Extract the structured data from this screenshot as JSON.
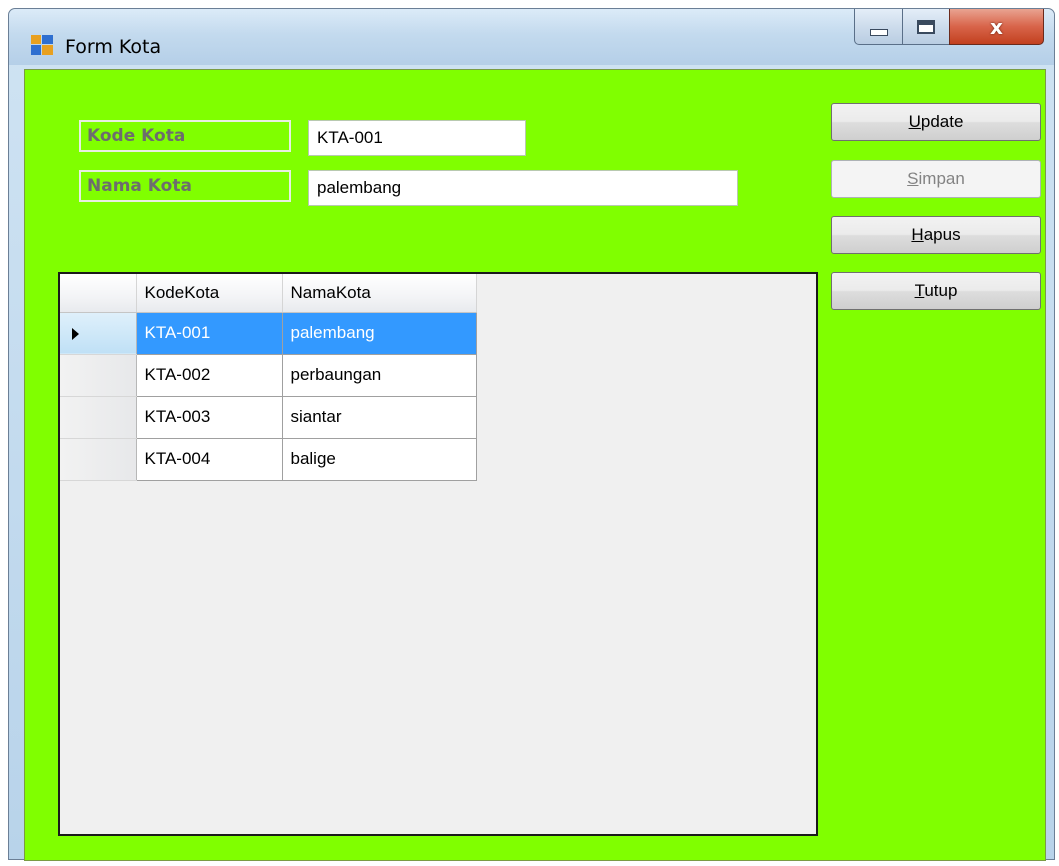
{
  "window": {
    "title": "Form Kota"
  },
  "form": {
    "kode_label": "Kode Kota",
    "kode_value": "KTA-001",
    "nama_label": "Nama Kota",
    "nama_value": "palembang"
  },
  "buttons": {
    "update": {
      "label": "Update",
      "mnemonic": "U",
      "rest": "pdate"
    },
    "simpan": {
      "label": "Simpan",
      "mnemonic": "S",
      "rest": "impan",
      "enabled": false
    },
    "hapus": {
      "label": "Hapus",
      "mnemonic": "H",
      "rest": "apus"
    },
    "tutup": {
      "label": "Tutup",
      "mnemonic": "T",
      "rest": "utup"
    }
  },
  "grid": {
    "columns": [
      "KodeKota",
      "NamaKota"
    ],
    "rows": [
      {
        "kode": "KTA-001",
        "nama": "palembang",
        "selected": true
      },
      {
        "kode": "KTA-002",
        "nama": "perbaungan",
        "selected": false
      },
      {
        "kode": "KTA-003",
        "nama": "siantar",
        "selected": false
      },
      {
        "kode": "KTA-004",
        "nama": "balige",
        "selected": false
      }
    ]
  },
  "colors": {
    "form_background": "#80ff00",
    "selection": "#3399ff"
  },
  "icons": {
    "app": "windows-form-icon",
    "minimize": "minimize-icon",
    "maximize": "maximize-icon",
    "close": "close-icon",
    "row_indicator": "current-row-arrow-icon"
  }
}
